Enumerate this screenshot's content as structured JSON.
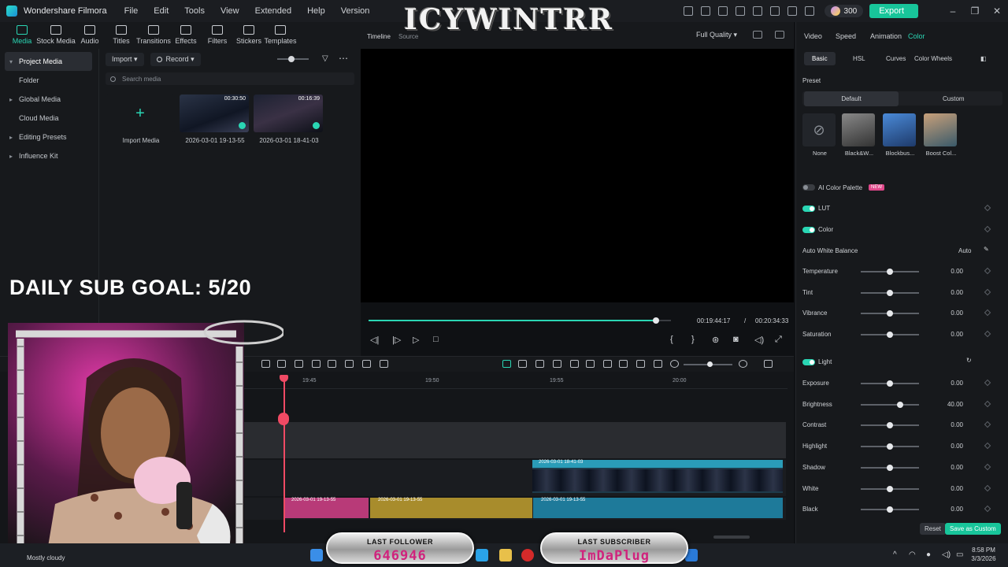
{
  "titlebar": {
    "app_name": "Wondershare Filmora",
    "menu": [
      "File",
      "Edit",
      "Tools",
      "View",
      "Extended",
      "Help",
      "Version"
    ],
    "credits": "300",
    "export_label": "Export"
  },
  "toolbar": {
    "tools": [
      {
        "label": "Media",
        "icon": "media-icon"
      },
      {
        "label": "Stock Media",
        "icon": "stock-media-icon"
      },
      {
        "label": "Audio",
        "icon": "audio-icon"
      },
      {
        "label": "Titles",
        "icon": "titles-icon"
      },
      {
        "label": "Transitions",
        "icon": "transitions-icon"
      },
      {
        "label": "Effects",
        "icon": "effects-icon"
      },
      {
        "label": "Filters",
        "icon": "filters-icon"
      },
      {
        "label": "Stickers",
        "icon": "stickers-icon"
      },
      {
        "label": "Templates",
        "icon": "templates-icon"
      }
    ]
  },
  "sidebar": {
    "items": [
      "Project Media",
      "Folder",
      "Global Media",
      "Cloud Media",
      "Editing Presets",
      "Influence Kit"
    ]
  },
  "media": {
    "import_label": "Import",
    "record_label": "Record",
    "search_placeholder": "Search media",
    "items": [
      {
        "name": "Import Media",
        "duration": ""
      },
      {
        "name": "2026-03-01 19-13-55",
        "duration": "00:30:50"
      },
      {
        "name": "2026-03-01 18-41-03",
        "duration": "00:16:39"
      }
    ]
  },
  "player": {
    "tabs": [
      "Timeline",
      "Source"
    ],
    "quality": "Full Quality",
    "current_time": "00:19:44:17",
    "separator": "/",
    "total_time": "00:20:34:33",
    "progress": 0.95
  },
  "right_panel": {
    "tabs": [
      "Video",
      "Speed",
      "Animation",
      "Color"
    ],
    "subtabs": [
      "Basic",
      "HSL",
      "Curves",
      "Color Wheels"
    ],
    "preset_label": "Preset",
    "preset_tabs": [
      "Default",
      "Custom"
    ],
    "presets": [
      "None",
      "Black&W...",
      "Blockbus...",
      "Boost Col..."
    ],
    "ai_palette": "AI Color Palette",
    "ai_badge": "NEW",
    "lut": "LUT",
    "color": "Color",
    "awb": "Auto White Balance",
    "auto": "Auto",
    "light": "Light",
    "color_sliders": [
      {
        "label": "Temperature",
        "value": "0.00",
        "level": 0.5
      },
      {
        "label": "Tint",
        "value": "0.00",
        "level": 0.5
      },
      {
        "label": "Vibrance",
        "value": "0.00",
        "level": 0.5
      },
      {
        "label": "Saturation",
        "value": "0.00",
        "level": 0.5
      }
    ],
    "light_sliders": [
      {
        "label": "Exposure",
        "value": "0.00",
        "level": 0.5
      },
      {
        "label": "Brightness",
        "value": "40.00",
        "level": 0.68
      },
      {
        "label": "Contrast",
        "value": "0.00",
        "level": 0.5
      },
      {
        "label": "Highlight",
        "value": "0.00",
        "level": 0.5
      },
      {
        "label": "Shadow",
        "value": "0.00",
        "level": 0.5
      },
      {
        "label": "White",
        "value": "0.00",
        "level": 0.5
      },
      {
        "label": "Black",
        "value": "0.00",
        "level": 0.5
      }
    ],
    "reset": "Reset",
    "save_custom": "Save as Custom"
  },
  "timeline": {
    "ticks": [
      "19:45",
      "19:50",
      "19:55",
      "20:00"
    ],
    "video_clip": "2026-03-01 18-41-03",
    "audio_clips": [
      "2026-03-01 19-13-55",
      "2026-03-01 19-13-55",
      "2026-03-01 19-13-55"
    ]
  },
  "overlay": {
    "goal": "DAILY SUB GOAL: 5/20",
    "brand": "ICYWINTRR",
    "last_follower_label": "LAST FOLLOWER",
    "last_follower": "646946",
    "last_subscriber_label": "LAST SUBSCRIBER",
    "last_subscriber": "ImDaPlug"
  },
  "taskbar": {
    "weather": "Mostly cloudy",
    "time": "8:58 PM",
    "date": "3/3/2026"
  },
  "colors": {
    "accent": "#2ad6b4",
    "export": "#18c59a",
    "playhead": "#f04a64"
  }
}
